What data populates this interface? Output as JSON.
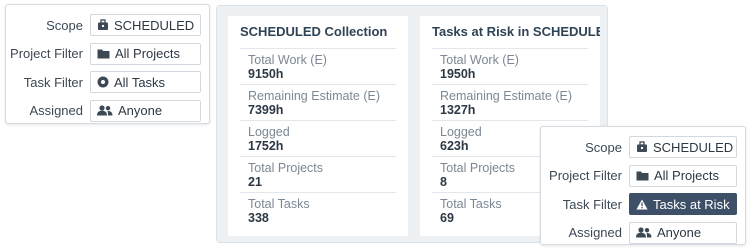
{
  "filters_left": {
    "scope": {
      "label": "Scope",
      "value": "SCHEDULED"
    },
    "project": {
      "label": "Project Filter",
      "value": "All Projects"
    },
    "task": {
      "label": "Task Filter",
      "value": "All Tasks"
    },
    "assigned": {
      "label": "Assigned",
      "value": "Anyone"
    }
  },
  "filters_right": {
    "scope": {
      "label": "Scope",
      "value": "SCHEDULED"
    },
    "project": {
      "label": "Project Filter",
      "value": "All Projects"
    },
    "task": {
      "label": "Task Filter",
      "value": "Tasks at Risk",
      "active": true
    },
    "assigned": {
      "label": "Assigned",
      "value": "Anyone"
    }
  },
  "cards": [
    {
      "title": "SCHEDULED Collection",
      "stats": [
        {
          "label": "Total Work (E)",
          "value": "9150h"
        },
        {
          "label": "Remaining Estimate (E)",
          "value": "7399h"
        },
        {
          "label": "Logged",
          "value": "1752h"
        },
        {
          "label": "Total Projects",
          "value": "21"
        },
        {
          "label": "Total Tasks",
          "value": "338"
        }
      ]
    },
    {
      "title": "Tasks at Risk in SCHEDULED",
      "stats": [
        {
          "label": "Total Work (E)",
          "value": "1950h"
        },
        {
          "label": "Remaining Estimate (E)",
          "value": "1327h"
        },
        {
          "label": "Logged",
          "value": "623h"
        },
        {
          "label": "Total Projects",
          "value": "8"
        },
        {
          "label": "Total Tasks",
          "value": "69"
        }
      ]
    }
  ],
  "icons": {
    "scope": "briefcase-icon",
    "project": "folder-icon",
    "task_all": "target-circle-icon",
    "task_risk": "warning-triangle-icon",
    "assigned": "users-icon"
  },
  "colors": {
    "active_button": "#3d5067",
    "panel_bg": "#eef1f4"
  }
}
